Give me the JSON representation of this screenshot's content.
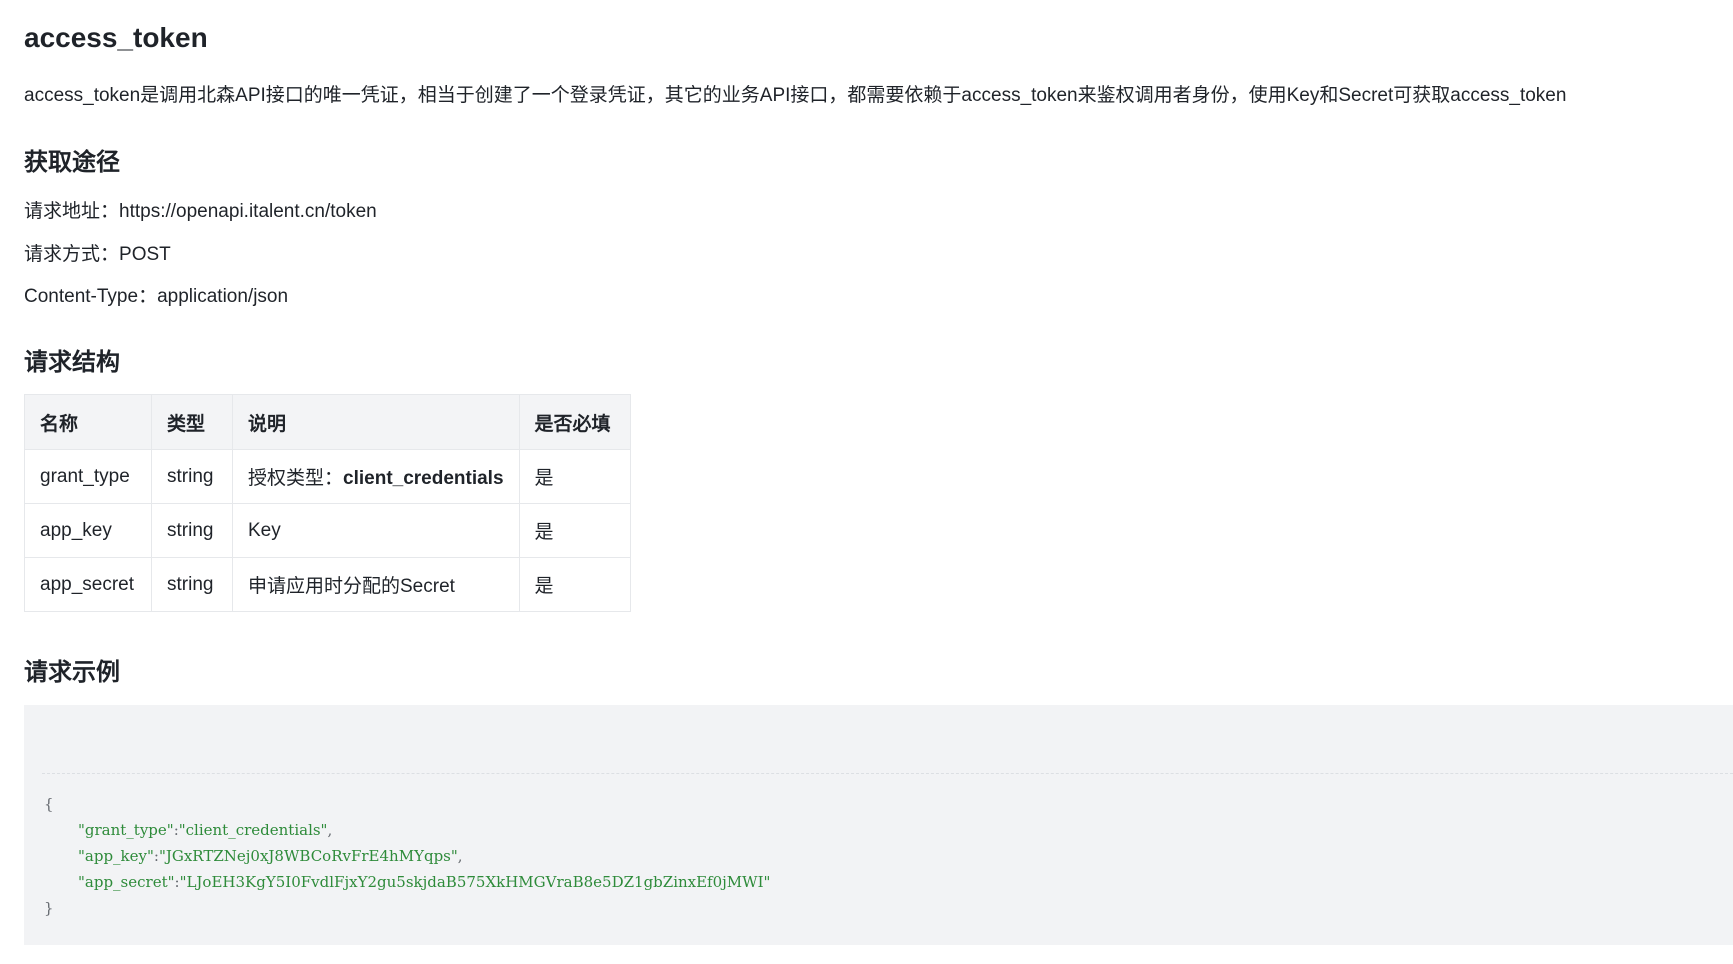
{
  "page": {
    "title": "access_token",
    "intro": "access_token是调用北森API接口的唯一凭证，相当于创建了一个登录凭证，其它的业务API接口，都需要依赖于access_token来鉴权调用者身份，使用Key和Secret可获取access_token"
  },
  "access_section": {
    "heading": "获取途径",
    "items": [
      {
        "label": "请求地址：",
        "value": "https://openapi.italent.cn/token"
      },
      {
        "label": "请求方式：",
        "value": "POST"
      },
      {
        "label": "Content-Type：",
        "value": "application/json"
      }
    ]
  },
  "structure_section": {
    "heading": "请求结构",
    "columns": [
      "名称",
      "类型",
      "说明",
      "是否必填"
    ],
    "rows": [
      {
        "name": "grant_type",
        "type": "string",
        "desc_prefix": "授权类型：",
        "desc_bold": "client_credentials",
        "required": "是"
      },
      {
        "name": "app_key",
        "type": "string",
        "desc_prefix": "Key",
        "desc_bold": "",
        "required": "是"
      },
      {
        "name": "app_secret",
        "type": "string",
        "desc_prefix": "申请应用时分配的Secret",
        "desc_bold": "",
        "required": "是"
      }
    ]
  },
  "example_section": {
    "heading": "请求示例",
    "open_brace": "{",
    "close_brace": "}",
    "lines": [
      {
        "key": "\"grant_type\"",
        "value": "\"client_credentials\"",
        "trail": ","
      },
      {
        "key": "\"app_key\"",
        "value": "\"JGxRTZNej0xJ8WBCoRvFrE4hMYqps\"",
        "trail": ","
      },
      {
        "key": "\"app_secret\"",
        "value": "\"LJoEH3KgY5I0FvdlFjxY2gu5skjdaB575XkHMGVraB8e5DZ1gbZinxEf0jMWI\"",
        "trail": ""
      }
    ]
  },
  "colors": {
    "text": "#1f2329",
    "table_header_bg": "#f3f4f6",
    "table_border": "#e6e8eb",
    "code_bg": "#f2f3f5",
    "code_string": "#2e8b3a"
  }
}
